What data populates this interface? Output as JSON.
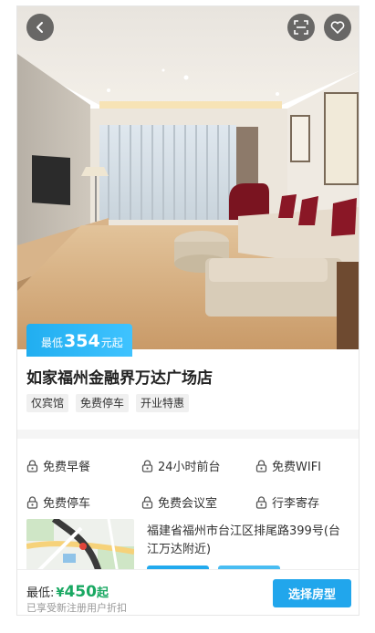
{
  "hotel": {
    "name": "如家福州金融界万达广场店",
    "price_prefix": "最低",
    "price": "354",
    "price_suffix": "元起",
    "tags": [
      "仅宾馆",
      "免费停车",
      "开业特惠"
    ]
  },
  "icons": {
    "back": "chevron-left-icon",
    "scan": "scan-icon",
    "favorite": "heart-icon",
    "facility": "lock-icon"
  },
  "facilities": [
    "免费早餐",
    "24小时前台",
    "免费WIFI",
    "免费停车",
    "免费会议室",
    "行李寄存"
  ],
  "address": "福建省福州市台江区排尾路399号(台江万达附近)",
  "bottom": {
    "min_label": "最低:",
    "currency": "¥",
    "min_price": "450",
    "min_suffix": "起",
    "note": "已享受新注册用户折扣",
    "select_button": "选择房型"
  },
  "colors": {
    "accent": "#21a6ec",
    "price_green": "#19a862"
  }
}
